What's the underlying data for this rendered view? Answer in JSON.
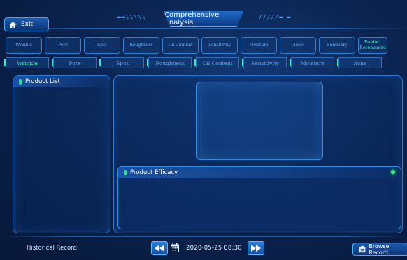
{
  "header": {
    "exit_label": "Exit",
    "title": "Comprehensive Analysis",
    "deco_left": "▬▬\\\\\\\\\\",
    "deco_right": "/////▬ ▬"
  },
  "analysis_tabs": [
    {
      "label": "Wrinkle",
      "active": false
    },
    {
      "label": "Pore",
      "active": false
    },
    {
      "label": "Spot",
      "active": false
    },
    {
      "label": "Roughness",
      "active": false
    },
    {
      "label": "Oil Content",
      "active": false
    },
    {
      "label": "Sensitivity",
      "active": false
    },
    {
      "label": "Moisture",
      "active": false
    },
    {
      "label": "Acne",
      "active": false
    },
    {
      "label": "Summary",
      "active": false
    },
    {
      "label": "Product Recommend",
      "active": true
    }
  ],
  "recommend_tabs": [
    {
      "label": "Wrinkle",
      "active": true
    },
    {
      "label": "Pore",
      "active": false
    },
    {
      "label": "Spot",
      "active": false
    },
    {
      "label": "Roughness",
      "active": false
    },
    {
      "label": "Oil Content",
      "active": false
    },
    {
      "label": "Sensitivity",
      "active": false
    },
    {
      "label": "Moisture",
      "active": false
    },
    {
      "label": "Acne",
      "active": false
    }
  ],
  "product_list": {
    "title": "Product List"
  },
  "product_efficacy": {
    "title": "Product Efficacy"
  },
  "footer": {
    "history_label": "Historical Record:",
    "record_date": "2020-05-25 08:30",
    "browse_label": "Browse Record"
  },
  "colors": {
    "accent": "#2cf0b5",
    "tab_text": "#6fb0ff",
    "border": "#2e7fd6",
    "status_dot": "#3cf07a"
  },
  "icons": [
    "home-icon",
    "leaf-icon",
    "prev-arrow-icon",
    "calendar-icon",
    "next-arrow-icon",
    "clipboard-icon"
  ]
}
